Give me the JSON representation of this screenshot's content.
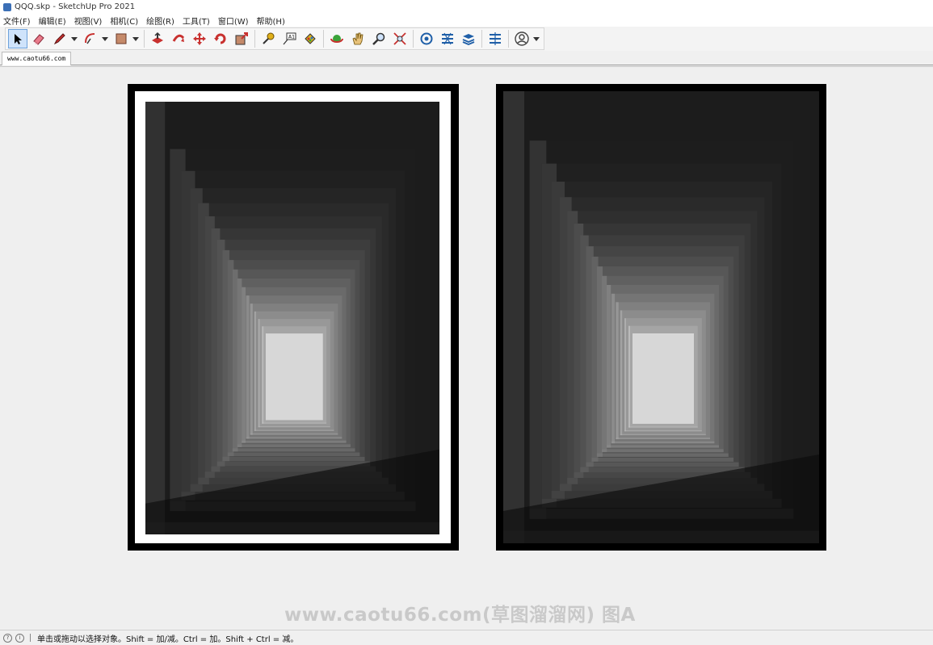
{
  "window": {
    "title": "QQQ.skp - SketchUp Pro 2021"
  },
  "menu": [
    "文件(F)",
    "编辑(E)",
    "视图(V)",
    "相机(C)",
    "绘图(R)",
    "工具(T)",
    "窗口(W)",
    "帮助(H)"
  ],
  "toolbar": {
    "tools": [
      "select-icon",
      "eraser-icon",
      "pencil-icon",
      "arc-icon",
      "paint-bucket-icon",
      "push-pull-icon",
      "follow-me-icon",
      "move-icon",
      "rotate-icon",
      "scale-icon",
      "tape-measure-icon",
      "text-icon",
      "materials-icon",
      "orbit-icon",
      "pan-icon",
      "zoom-icon",
      "zoom-extents-icon",
      "warehouse-icon",
      "extension-icon",
      "layers-icon",
      "components-icon",
      "account-icon"
    ]
  },
  "scene_tab": {
    "label": "www.caotu66.com"
  },
  "watermark": {
    "text": "www.caotu66.com(草图溜溜网) 图A"
  },
  "status": {
    "message": "单击或拖动以选择对象。Shift = 加/减。Ctrl = 加。Shift + Ctrl = 减。"
  },
  "colors": {
    "accent": "#3b6fb6",
    "frame": "#000000",
    "mat": "#ffffff"
  }
}
